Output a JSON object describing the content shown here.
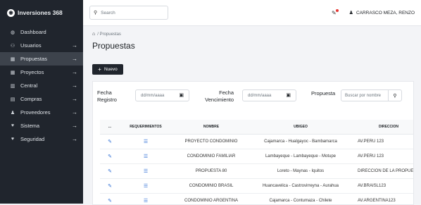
{
  "sidebar": {
    "brand": "Inversiones 368",
    "items": [
      {
        "label": "Dashboard",
        "icon": "dashboard-icon",
        "glyph": "◍",
        "has_arrow": false,
        "active": false
      },
      {
        "label": "Usuarios",
        "icon": "users-icon",
        "glyph": "⚇",
        "has_arrow": true,
        "active": false
      },
      {
        "label": "Propuestas",
        "icon": "building-icon",
        "glyph": "▦",
        "has_arrow": true,
        "active": true
      },
      {
        "label": "Proyectos",
        "icon": "buildings-icon",
        "glyph": "▦",
        "has_arrow": true,
        "active": false
      },
      {
        "label": "Central",
        "icon": "bank-icon",
        "glyph": "▥",
        "has_arrow": true,
        "active": false
      },
      {
        "label": "Compras",
        "icon": "receipt-icon",
        "glyph": "▤",
        "has_arrow": true,
        "active": false
      },
      {
        "label": "Proveedores",
        "icon": "person-icon",
        "glyph": "♟",
        "has_arrow": true,
        "active": false
      },
      {
        "label": "Sistema",
        "icon": "heart-icon",
        "glyph": "♥",
        "has_arrow": true,
        "active": false
      },
      {
        "label": "Seguridad",
        "icon": "heart-icon",
        "glyph": "♥",
        "has_arrow": true,
        "active": false
      }
    ]
  },
  "topbar": {
    "search_placeholder": "Search",
    "user_name": "CARRASCO MEZA, RENZO"
  },
  "breadcrumb": "/ Propuestas",
  "page_title": "Propuestas",
  "new_button": "Nuevo",
  "filters": {
    "fecha_registro_label": "Fecha Registro",
    "fecha_vencimiento_label": "Fecha Vencimiento",
    "date_placeholder": "dd/mm/aaaa",
    "propuesta_label": "Propuesta",
    "propuesta_placeholder": "Buscar por nombre"
  },
  "table": {
    "columns": [
      "...",
      "REQUERIMIENTOS",
      "NOMBRE",
      "UBIGEO",
      "DIRECCION"
    ],
    "rows": [
      {
        "nombre": "PROYECTO CONDOMINIO",
        "ubigeo": "Cajamarca - Hualgayoc - Bambamarca",
        "direccion": "AV.PERU 123"
      },
      {
        "nombre": "CONDOMINIO FAMILIAR",
        "ubigeo": "Lambayeque - Lambayeque - Motupe",
        "direccion": "AV.PERU 123"
      },
      {
        "nombre": "PROPUESTA 80",
        "ubigeo": "Loreto - Maynas - Iquitos",
        "direccion": "DIRECCION DE LA PROPUES"
      },
      {
        "nombre": "CONDOMINIO BRASIL",
        "ubigeo": "Huancavelica - Castrovirreyna - Aurahua",
        "direccion": "AV.BRAISL123"
      },
      {
        "nombre": "CONDOMINIO ARGENTINA",
        "ubigeo": "Cajamarca - Contumaza - Chilete",
        "direccion": "AV.ARGENTINA123"
      }
    ]
  },
  "colors": {
    "sidebar_bg": "#20252d",
    "active_item_bg": "#3d434c",
    "action_icon": "#2f6fd6"
  }
}
